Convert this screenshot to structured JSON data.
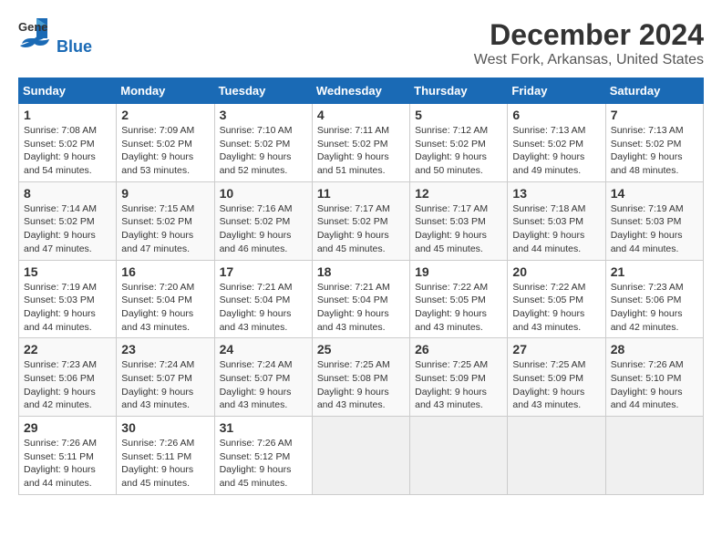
{
  "header": {
    "logo_line1": "General",
    "logo_line2": "Blue",
    "main_title": "December 2024",
    "subtitle": "West Fork, Arkansas, United States"
  },
  "days_of_week": [
    "Sunday",
    "Monday",
    "Tuesday",
    "Wednesday",
    "Thursday",
    "Friday",
    "Saturday"
  ],
  "weeks": [
    [
      {
        "day": "1",
        "sunrise": "7:08 AM",
        "sunset": "5:02 PM",
        "daylight": "9 hours and 54 minutes."
      },
      {
        "day": "2",
        "sunrise": "7:09 AM",
        "sunset": "5:02 PM",
        "daylight": "9 hours and 53 minutes."
      },
      {
        "day": "3",
        "sunrise": "7:10 AM",
        "sunset": "5:02 PM",
        "daylight": "9 hours and 52 minutes."
      },
      {
        "day": "4",
        "sunrise": "7:11 AM",
        "sunset": "5:02 PM",
        "daylight": "9 hours and 51 minutes."
      },
      {
        "day": "5",
        "sunrise": "7:12 AM",
        "sunset": "5:02 PM",
        "daylight": "9 hours and 50 minutes."
      },
      {
        "day": "6",
        "sunrise": "7:13 AM",
        "sunset": "5:02 PM",
        "daylight": "9 hours and 49 minutes."
      },
      {
        "day": "7",
        "sunrise": "7:13 AM",
        "sunset": "5:02 PM",
        "daylight": "9 hours and 48 minutes."
      }
    ],
    [
      {
        "day": "8",
        "sunrise": "7:14 AM",
        "sunset": "5:02 PM",
        "daylight": "9 hours and 47 minutes."
      },
      {
        "day": "9",
        "sunrise": "7:15 AM",
        "sunset": "5:02 PM",
        "daylight": "9 hours and 47 minutes."
      },
      {
        "day": "10",
        "sunrise": "7:16 AM",
        "sunset": "5:02 PM",
        "daylight": "9 hours and 46 minutes."
      },
      {
        "day": "11",
        "sunrise": "7:17 AM",
        "sunset": "5:02 PM",
        "daylight": "9 hours and 45 minutes."
      },
      {
        "day": "12",
        "sunrise": "7:17 AM",
        "sunset": "5:03 PM",
        "daylight": "9 hours and 45 minutes."
      },
      {
        "day": "13",
        "sunrise": "7:18 AM",
        "sunset": "5:03 PM",
        "daylight": "9 hours and 44 minutes."
      },
      {
        "day": "14",
        "sunrise": "7:19 AM",
        "sunset": "5:03 PM",
        "daylight": "9 hours and 44 minutes."
      }
    ],
    [
      {
        "day": "15",
        "sunrise": "7:19 AM",
        "sunset": "5:03 PM",
        "daylight": "9 hours and 44 minutes."
      },
      {
        "day": "16",
        "sunrise": "7:20 AM",
        "sunset": "5:04 PM",
        "daylight": "9 hours and 43 minutes."
      },
      {
        "day": "17",
        "sunrise": "7:21 AM",
        "sunset": "5:04 PM",
        "daylight": "9 hours and 43 minutes."
      },
      {
        "day": "18",
        "sunrise": "7:21 AM",
        "sunset": "5:04 PM",
        "daylight": "9 hours and 43 minutes."
      },
      {
        "day": "19",
        "sunrise": "7:22 AM",
        "sunset": "5:05 PM",
        "daylight": "9 hours and 43 minutes."
      },
      {
        "day": "20",
        "sunrise": "7:22 AM",
        "sunset": "5:05 PM",
        "daylight": "9 hours and 43 minutes."
      },
      {
        "day": "21",
        "sunrise": "7:23 AM",
        "sunset": "5:06 PM",
        "daylight": "9 hours and 42 minutes."
      }
    ],
    [
      {
        "day": "22",
        "sunrise": "7:23 AM",
        "sunset": "5:06 PM",
        "daylight": "9 hours and 42 minutes."
      },
      {
        "day": "23",
        "sunrise": "7:24 AM",
        "sunset": "5:07 PM",
        "daylight": "9 hours and 43 minutes."
      },
      {
        "day": "24",
        "sunrise": "7:24 AM",
        "sunset": "5:07 PM",
        "daylight": "9 hours and 43 minutes."
      },
      {
        "day": "25",
        "sunrise": "7:25 AM",
        "sunset": "5:08 PM",
        "daylight": "9 hours and 43 minutes."
      },
      {
        "day": "26",
        "sunrise": "7:25 AM",
        "sunset": "5:09 PM",
        "daylight": "9 hours and 43 minutes."
      },
      {
        "day": "27",
        "sunrise": "7:25 AM",
        "sunset": "5:09 PM",
        "daylight": "9 hours and 43 minutes."
      },
      {
        "day": "28",
        "sunrise": "7:26 AM",
        "sunset": "5:10 PM",
        "daylight": "9 hours and 44 minutes."
      }
    ],
    [
      {
        "day": "29",
        "sunrise": "7:26 AM",
        "sunset": "5:11 PM",
        "daylight": "9 hours and 44 minutes."
      },
      {
        "day": "30",
        "sunrise": "7:26 AM",
        "sunset": "5:11 PM",
        "daylight": "9 hours and 45 minutes."
      },
      {
        "day": "31",
        "sunrise": "7:26 AM",
        "sunset": "5:12 PM",
        "daylight": "9 hours and 45 minutes."
      },
      null,
      null,
      null,
      null
    ]
  ],
  "labels": {
    "sunrise": "Sunrise:",
    "sunset": "Sunset:",
    "daylight": "Daylight:"
  }
}
